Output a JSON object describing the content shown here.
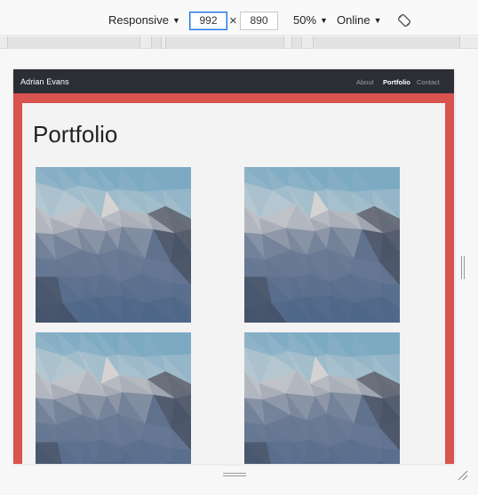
{
  "devtools": {
    "device_label": "Responsive",
    "width_value": "992",
    "height_value": "890",
    "zoom_label": "50%",
    "throttle_label": "Online",
    "dropdown_arrow": "▼",
    "times_symbol": "×"
  },
  "site": {
    "brand": "Adrian Evans",
    "nav": [
      "About",
      "Portfolio",
      "Contact"
    ],
    "active_nav": "Portfolio",
    "title": "Portfolio",
    "accent_color": "#d9534f",
    "navbar_color": "#2b2f35",
    "thumbnails": [
      "low-poly-image",
      "low-poly-image",
      "low-poly-image",
      "low-poly-image"
    ]
  }
}
